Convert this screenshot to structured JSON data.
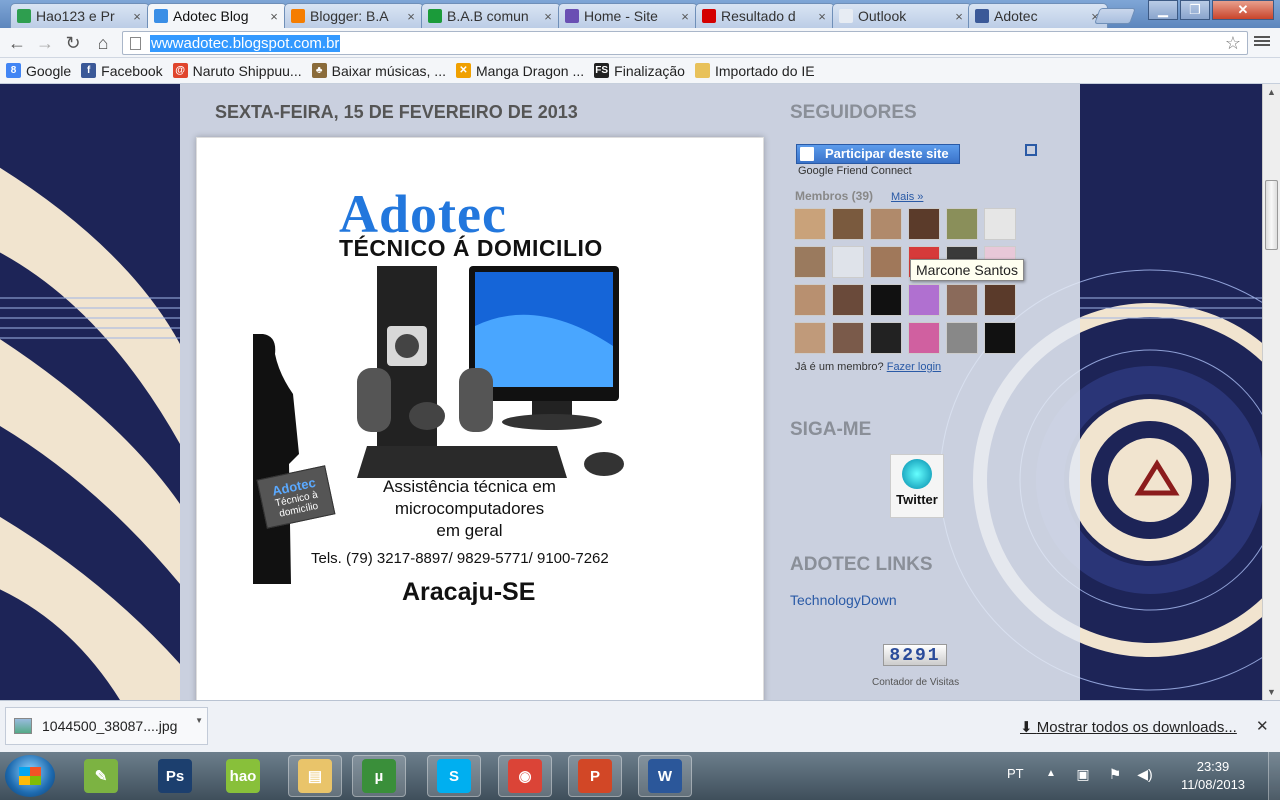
{
  "browser": {
    "tabs": [
      {
        "label": "Hao123 e Pr",
        "icon": "hao123-icon",
        "color": "#2e9e4f",
        "active": false
      },
      {
        "label": "Adotec Blog",
        "icon": "adotec-bird-icon",
        "color": "#3a8ee6",
        "active": true
      },
      {
        "label": "Blogger: B.A",
        "icon": "blogger-icon",
        "color": "#f57d00",
        "active": false
      },
      {
        "label": "B.A.B comun",
        "icon": "brazil-flag-icon",
        "color": "#1b9b3a",
        "active": false
      },
      {
        "label": "Home - Site",
        "icon": "site-icon",
        "color": "#6a4fb3",
        "active": false
      },
      {
        "label": "Resultado d",
        "icon": "youtube-icon",
        "color": "#d40000",
        "active": false
      },
      {
        "label": "Outlook",
        "icon": "outlook-icon",
        "color": "#e7ecf3",
        "active": false
      },
      {
        "label": "Adotec",
        "icon": "facebook-icon",
        "color": "#3b5998",
        "active": false
      }
    ],
    "url": "wwwadotec.blogspot.com.br",
    "bookmarks": [
      {
        "label": "Google",
        "icon": "google-icon",
        "color": "#4285f4",
        "glyph": "8"
      },
      {
        "label": "Facebook",
        "icon": "facebook-icon",
        "color": "#3b5998",
        "glyph": "f"
      },
      {
        "label": "Naruto Shippuu...",
        "icon": "naruto-icon",
        "color": "#e0452d",
        "glyph": "@"
      },
      {
        "label": "Baixar músicas, ...",
        "icon": "music-icon",
        "color": "#8a6b3a",
        "glyph": "♣"
      },
      {
        "label": "Manga Dragon ...",
        "icon": "manga-icon",
        "color": "#f0a000",
        "glyph": "✕"
      },
      {
        "label": "Finalização",
        "icon": "fs-icon",
        "color": "#222222",
        "glyph": "FS"
      },
      {
        "label": "Importado do IE",
        "icon": "folder-icon",
        "color": "#e8c15a",
        "glyph": ""
      }
    ]
  },
  "page": {
    "post_date": "SEXTA-FEIRA, 15 DE FEVEREIRO DE 2013",
    "ad": {
      "logo": "Adotec",
      "tagline": "TÉCNICO Á DOMICILIO",
      "service_lines": [
        "Assistência técnica em",
        "microcomputadores",
        "em geral"
      ],
      "phones": "Tels. (79) 3217-8897/ 9829-5771/ 9100-7262",
      "city": "Aracaju-SE",
      "badge_title": "Adotec",
      "badge_text": "Técnico à domicílio"
    },
    "sidebar": {
      "followers_title": "SEGUIDORES",
      "join_button": "Participar deste site",
      "gfc_caption": "Google Friend Connect",
      "members_label": "Membros (39)",
      "more_link": "Mais »",
      "member_question": "Já é um membro?",
      "login_link": "Fazer login",
      "tooltip": "Marcone Santos",
      "follow_title": "SIGA-ME",
      "twitter_label": "Twitter",
      "links_title": "ADOTEC LINKS",
      "links": [
        "TechnologyDown"
      ],
      "counter_value": "8291",
      "counter_caption": "Contador de Visitas"
    }
  },
  "downloads": {
    "file": "1044500_38087....jpg",
    "show_all": "Mostrar todos os downloads..."
  },
  "taskbar": {
    "apps": [
      {
        "name": "greenshot-app",
        "color": "#7cb342",
        "glyph": "✎",
        "pinned": false
      },
      {
        "name": "photoshop-app",
        "color": "#1c3f6e",
        "glyph": "Ps",
        "pinned": false
      },
      {
        "name": "hao123-app",
        "color": "#88c03a",
        "glyph": "hao",
        "pinned": false
      },
      {
        "name": "explorer-app",
        "color": "#e9c46a",
        "glyph": "▤",
        "pinned": true
      },
      {
        "name": "utorrent-app",
        "color": "#3a8f3a",
        "glyph": "µ",
        "pinned": true
      },
      {
        "name": "skype-app",
        "color": "#00aff0",
        "glyph": "S",
        "pinned": true
      },
      {
        "name": "chrome-app",
        "color": "#db4437",
        "glyph": "◉",
        "pinned": true
      },
      {
        "name": "powerpoint-app",
        "color": "#d24726",
        "glyph": "P",
        "pinned": true
      },
      {
        "name": "word-app",
        "color": "#2b579a",
        "glyph": "W",
        "pinned": true
      }
    ],
    "language": "PT",
    "time": "23:39",
    "date": "11/08/2013"
  }
}
